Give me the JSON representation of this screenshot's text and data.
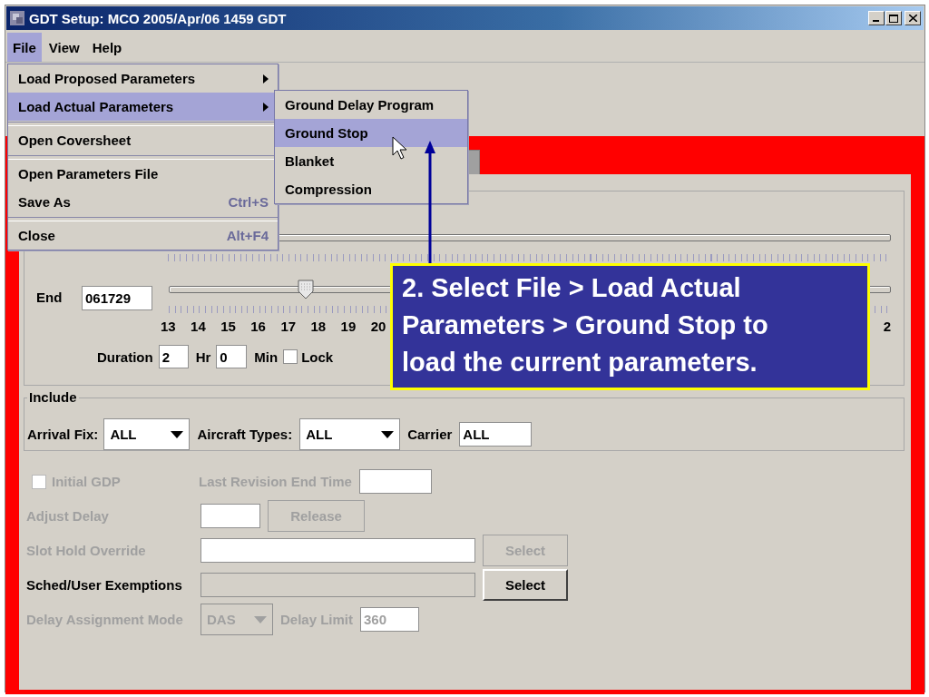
{
  "window": {
    "title": "GDT Setup: MCO 2005/Apr/06 1459 GDT"
  },
  "menubar": [
    {
      "label": "File",
      "selected": true
    },
    {
      "label": "View",
      "selected": false
    },
    {
      "label": "Help",
      "selected": false
    }
  ],
  "file_menu": [
    {
      "kind": "item",
      "label": "Load Proposed Parameters",
      "submenu": true,
      "selected": false
    },
    {
      "kind": "item",
      "label": "Load Actual Parameters",
      "submenu": true,
      "selected": true
    },
    {
      "kind": "separator"
    },
    {
      "kind": "item",
      "label": "Open Coversheet",
      "selected": false
    },
    {
      "kind": "separator"
    },
    {
      "kind": "item",
      "label": "Open Parameters File",
      "selected": false
    },
    {
      "kind": "item",
      "label": "Save As",
      "shortcut": "Ctrl+S",
      "selected": false
    },
    {
      "kind": "separator"
    },
    {
      "kind": "item",
      "label": "Close",
      "shortcut": "Alt+F4",
      "selected": false
    }
  ],
  "load_actual_submenu": [
    {
      "kind": "item",
      "label": "Ground Delay Program",
      "selected": false
    },
    {
      "kind": "item",
      "label": "Ground Stop",
      "selected": true
    },
    {
      "kind": "item",
      "label": "Blanket",
      "selected": false
    },
    {
      "kind": "item",
      "label": "Compression",
      "selected": false
    }
  ],
  "time_range": {
    "end_label": "End",
    "end_value": "061729",
    "end_slider": {
      "level": 0.19
    },
    "tick_labels": [
      "13",
      "14",
      "15",
      "16",
      "17",
      "18",
      "19",
      "20",
      "2"
    ],
    "duration_label": "Duration",
    "hours": "2",
    "hr_label": "Hr",
    "minutes": "0",
    "min_label": "Min",
    "lock": {
      "label": "Lock",
      "checked": false
    }
  },
  "include": {
    "title": "Include",
    "arrival_fix": {
      "label": "Arrival Fix:",
      "value": "ALL"
    },
    "aircraft_types": {
      "label": "Aircraft Types:",
      "value": "ALL"
    },
    "carrier": {
      "label": "Carrier",
      "value": "ALL"
    }
  },
  "options": {
    "initial_gdp": {
      "label": "Initial GDP",
      "checked": false,
      "disabled": true
    },
    "last_revision": {
      "label": "Last Revision End Time",
      "disabled": true
    },
    "adjust_delay": {
      "label": "Adjust Delay",
      "disabled": true
    },
    "release": {
      "label": "Release",
      "disabled": true
    },
    "slot_hold": {
      "label": "Slot Hold Override",
      "disabled": true
    },
    "slot_hold_select": {
      "label": "Select",
      "disabled": true
    },
    "exemptions": {
      "label": "Sched/User Exemptions",
      "disabled": false
    },
    "exemptions_select": {
      "label": "Select",
      "disabled": false
    },
    "delay_mode": {
      "label": "Delay Assignment Mode",
      "value": "DAS",
      "disabled": true
    },
    "delay_limit": {
      "label": "Delay Limit",
      "value": "360",
      "disabled": true
    }
  },
  "callout": {
    "text": "2. Select File > Load Actual Parameters > Ground Stop to load the current parameters."
  }
}
